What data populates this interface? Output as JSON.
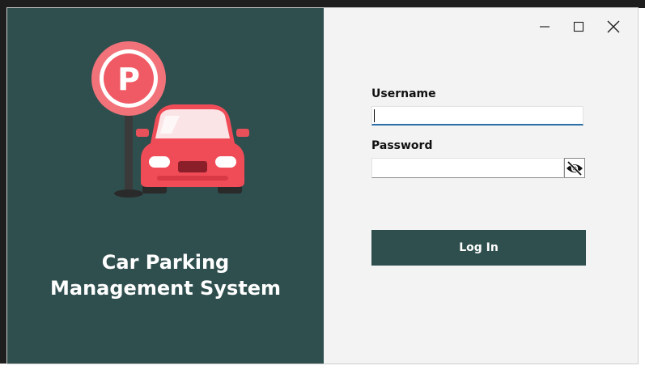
{
  "window": {
    "controls": {
      "minimize_icon": "minimize-icon",
      "maximize_icon": "maximize-icon",
      "close_icon": "close-icon"
    }
  },
  "brand": {
    "title_line1": "Car Parking",
    "title_line2": "Management System",
    "illustration": "parking-sign-with-red-car",
    "panel_color": "#2f4f4e"
  },
  "login_form": {
    "username_label": "Username",
    "username_value": "",
    "password_label": "Password",
    "password_value": "",
    "password_toggle_icon": "eye-slash-icon",
    "login_button_label": "Log In",
    "button_color": "#2f4f4e",
    "focus_accent": "#2b6ea6"
  }
}
